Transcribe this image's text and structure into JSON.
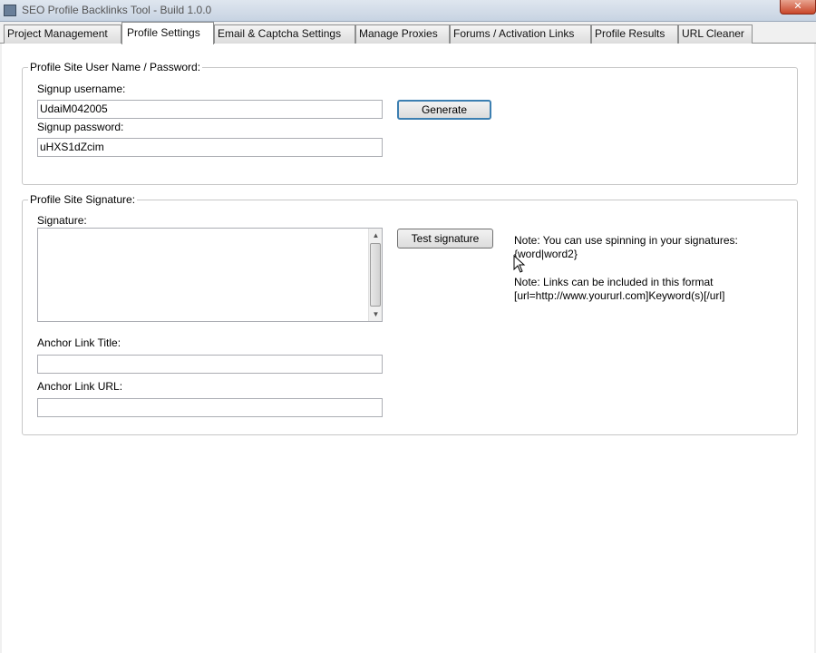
{
  "window": {
    "title": "SEO Profile Backlinks Tool - Build 1.0.0",
    "close_label": "✕"
  },
  "tabs": [
    {
      "label": "Project Management",
      "active": false
    },
    {
      "label": "Profile Settings",
      "active": true
    },
    {
      "label": "Email & Captcha Settings",
      "active": false
    },
    {
      "label": "Manage Proxies",
      "active": false
    },
    {
      "label": "Forums / Activation Links",
      "active": false
    },
    {
      "label": "Profile Results",
      "active": false
    },
    {
      "label": "URL Cleaner",
      "active": false
    }
  ],
  "credentials": {
    "legend": "Profile Site User Name / Password:",
    "username_label": "Signup username:",
    "username_value": "UdaiM042005",
    "generate_label": "Generate",
    "password_label": "Signup password:",
    "password_value": "uHXS1dZcim"
  },
  "signature": {
    "legend": "Profile Site Signature:",
    "signature_label": "Signature:",
    "signature_value": "",
    "test_label": "Test signature",
    "note_spin_1": "Note: You can use spinning in your signatures:",
    "note_spin_2": "{word|word2}",
    "note_links_1": "Note: Links can be included in this format",
    "note_links_2": "[url=http://www.yoururl.com]Keyword(s)[/url]",
    "anchor_title_label": "Anchor Link Title:",
    "anchor_title_value": "",
    "anchor_url_label": "Anchor Link URL:",
    "anchor_url_value": ""
  }
}
